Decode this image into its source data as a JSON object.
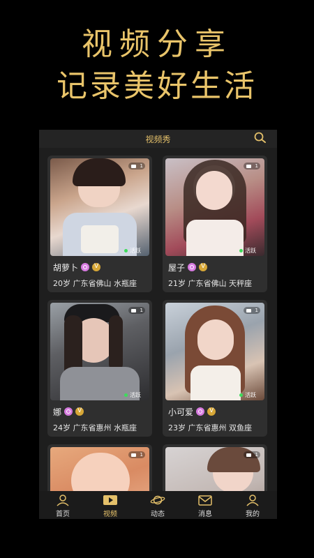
{
  "hero": {
    "line1": "视频分享",
    "line2": "记录美好生活"
  },
  "header": {
    "title": "视频秀",
    "search_icon": "search-icon"
  },
  "cards": [
    {
      "name": "胡萝卜",
      "info": "20岁 广东省佛山 水瓶座",
      "active_label": "活跃",
      "video_count": "1"
    },
    {
      "name": "屋子",
      "info": "21岁 广东省佛山 天秤座",
      "active_label": "活跃",
      "video_count": "1"
    },
    {
      "name": "娜",
      "info": "24岁 广东省惠州 水瓶座",
      "active_label": "活跃",
      "video_count": "1"
    },
    {
      "name": "小可爱",
      "info": "23岁 广东省惠州 双鱼座",
      "active_label": "活跃",
      "video_count": "1"
    },
    {
      "name": "",
      "info": "",
      "active_label": "",
      "video_count": "1"
    },
    {
      "name": "",
      "info": "",
      "active_label": "",
      "video_count": "1"
    }
  ],
  "tabs": [
    {
      "label": "首页",
      "icon": "home-person-icon"
    },
    {
      "label": "视频",
      "icon": "video-play-icon"
    },
    {
      "label": "动态",
      "icon": "planet-icon"
    },
    {
      "label": "消息",
      "icon": "mail-icon"
    },
    {
      "label": "我的",
      "icon": "user-icon"
    }
  ],
  "colors": {
    "accent": "#e4c06a",
    "background": "#000000",
    "card": "#2f2f2f",
    "active_dot": "#3ddc5b"
  }
}
